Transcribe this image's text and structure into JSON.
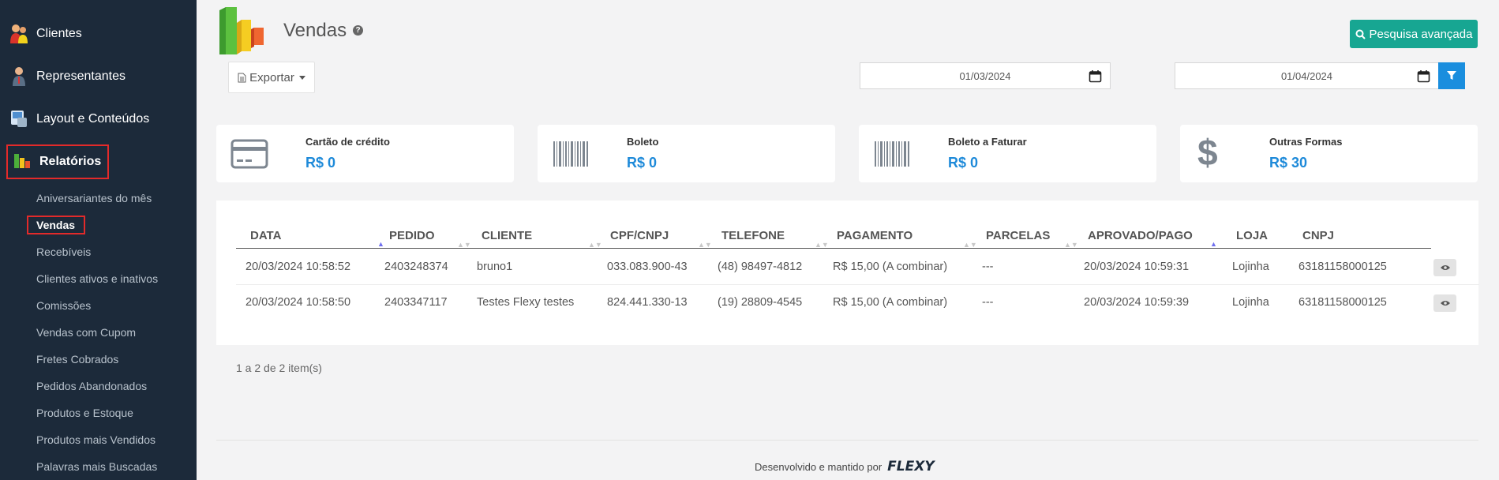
{
  "sidebar": {
    "main_items": [
      {
        "label": "Clientes",
        "icon": "clients-icon"
      },
      {
        "label": "Representantes",
        "icon": "representative-icon"
      },
      {
        "label": "Layout e Conteúdos",
        "icon": "layout-icon"
      },
      {
        "label": "Relatórios",
        "icon": "reports-icon",
        "active": true
      }
    ],
    "sub_items": [
      {
        "label": "Aniversariantes do mês"
      },
      {
        "label": "Vendas",
        "active": true
      },
      {
        "label": "Recebíveis"
      },
      {
        "label": "Clientes ativos e inativos"
      },
      {
        "label": "Comissões"
      },
      {
        "label": "Vendas com Cupom"
      },
      {
        "label": "Fretes Cobrados"
      },
      {
        "label": "Pedidos Abandonados"
      },
      {
        "label": "Produtos e Estoque"
      },
      {
        "label": "Produtos mais Vendidos"
      },
      {
        "label": "Palavras mais Buscadas"
      }
    ]
  },
  "header": {
    "title": "Vendas",
    "help_symbol": "?",
    "advanced_search_label": "Pesquisa avançada",
    "export_label": "Exportar",
    "date_from": "01/03/2024",
    "date_to": "01/04/2024"
  },
  "cards": [
    {
      "label": "Cartão de crédito",
      "value": "R$ 0",
      "icon": "credit-card-icon"
    },
    {
      "label": "Boleto",
      "value": "R$ 0",
      "icon": "barcode-icon"
    },
    {
      "label": "Boleto a Faturar",
      "value": "R$ 0",
      "icon": "barcode-icon"
    },
    {
      "label": "Outras Formas",
      "value": "R$ 30",
      "icon": "dollar-icon"
    }
  ],
  "table": {
    "columns": [
      "DATA",
      "PEDIDO",
      "CLIENTE",
      "CPF/CNPJ",
      "TELEFONE",
      "PAGAMENTO",
      "PARCELAS",
      "APROVADO/PAGO",
      "LOJA",
      "CNPJ"
    ],
    "rows": [
      [
        "20/03/2024 10:58:52",
        "2403248374",
        "bruno1",
        "033.083.900-43",
        "(48) 98497-4812",
        "R$ 15,00 (A combinar)",
        "---",
        "20/03/2024 10:59:31",
        "Lojinha",
        "63181158000125"
      ],
      [
        "20/03/2024 10:58:50",
        "2403347117",
        "Testes Flexy testes",
        "824.441.330-13",
        "(19) 28809-4545",
        "R$ 15,00 (A combinar)",
        "---",
        "20/03/2024 10:59:39",
        "Lojinha",
        "63181158000125"
      ]
    ],
    "pagination_info": "1 a 2 de 2 item(s)"
  },
  "footer": {
    "text": "Desenvolvido e mantido por",
    "brand": "FLEXY"
  },
  "colors": {
    "sidebar_bg": "#1c2a3a",
    "accent_teal": "#17a692",
    "accent_blue": "#1a8ede",
    "value_blue": "#1e8ad9",
    "highlight_red": "#e32a2a"
  }
}
